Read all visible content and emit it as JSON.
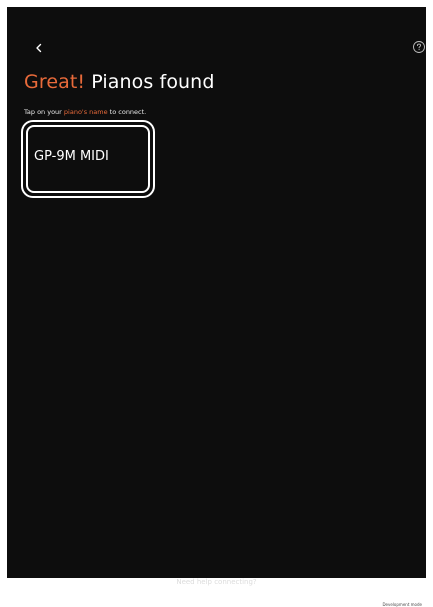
{
  "header": {
    "back_icon": "chevron-left-icon",
    "help_icon": "question-circle-icon"
  },
  "title": {
    "accent": "Great!",
    "rest": " Pianos found"
  },
  "instruction": {
    "prefix": "Tap on your ",
    "highlight": "piano's name",
    "suffix": " to connect."
  },
  "pianos": [
    {
      "name": "GP-9M MIDI"
    }
  ],
  "footer": {
    "help_link": "Need help connecting?",
    "dev_mode": "Development mode"
  },
  "colors": {
    "background": "#0d0d0d",
    "accent": "#e86a3a",
    "text": "#ffffff"
  }
}
